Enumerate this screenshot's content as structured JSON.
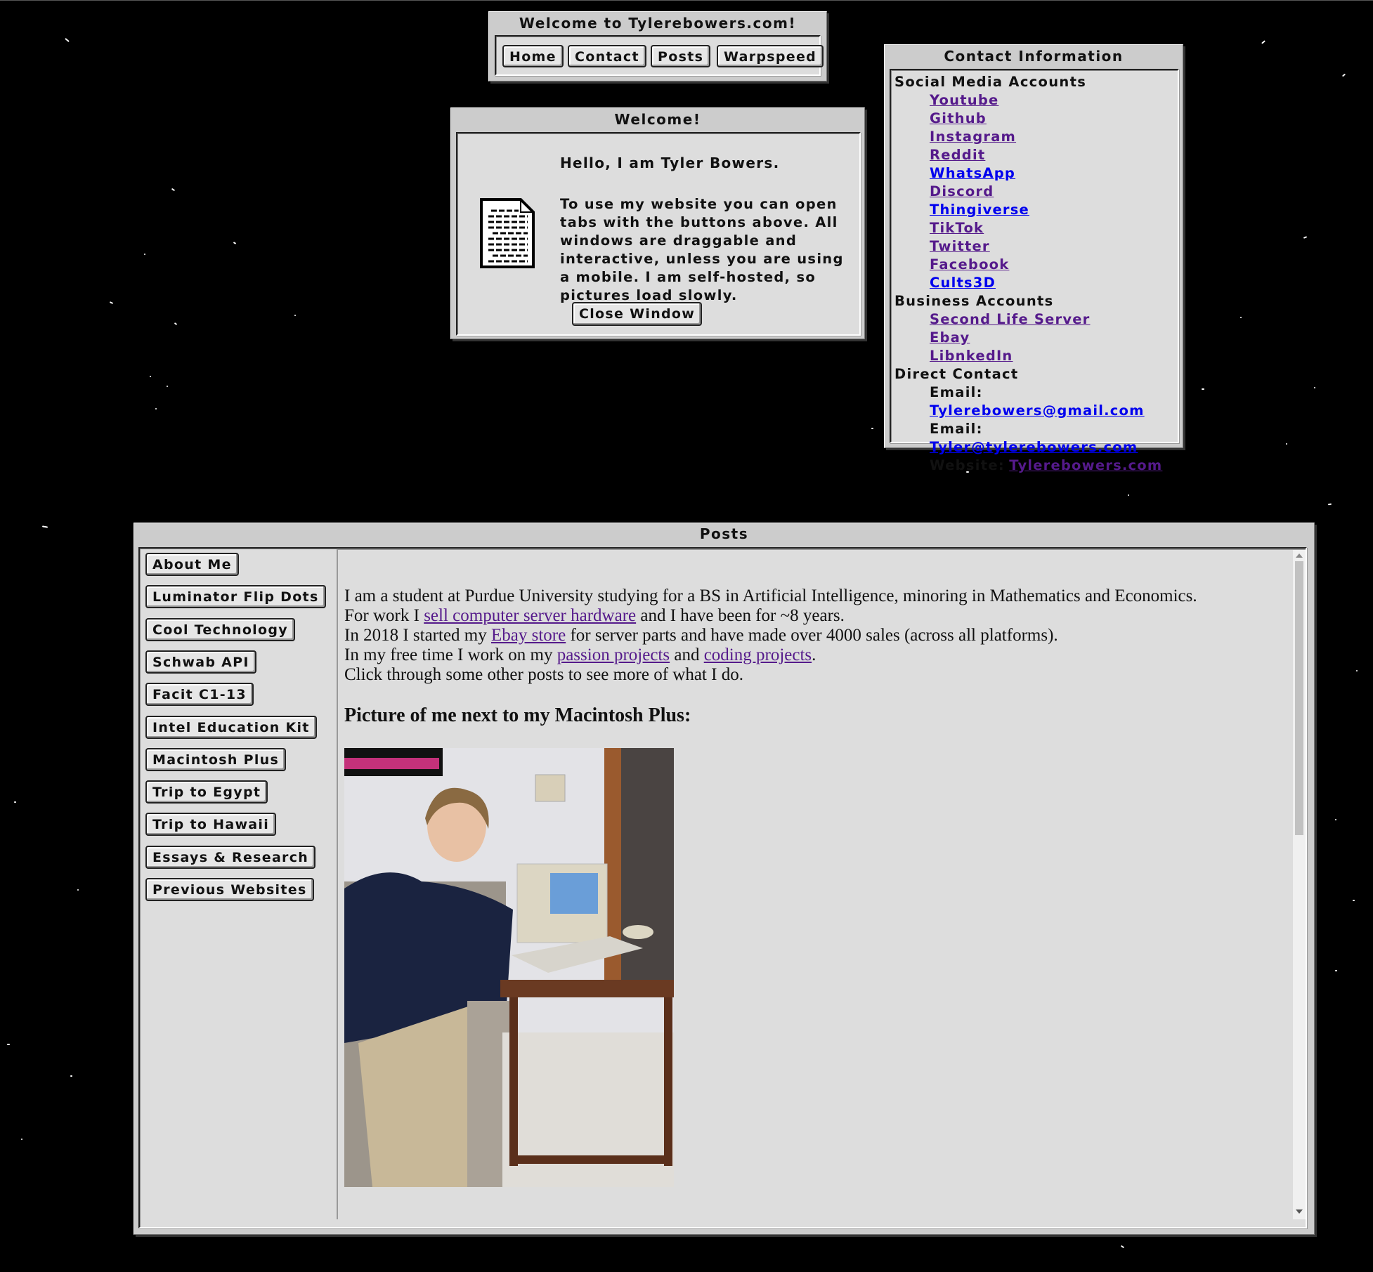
{
  "nav_window": {
    "title": "Welcome to Tylerebowers.com!",
    "buttons": [
      "Home",
      "Contact",
      "Posts",
      "Warpspeed"
    ]
  },
  "welcome_window": {
    "title": "Welcome!",
    "icon": "document-icon",
    "greeting": "Hello, I am Tyler Bowers.",
    "body": "To use my website you can open tabs with the buttons above. All windows are draggable and interactive, unless you are using a mobile. I am self-hosted, so pictures load slowly.",
    "close_label": "Close Window"
  },
  "contact_window": {
    "title": "Contact Information",
    "sections": [
      {
        "heading": "Social Media Accounts",
        "links": [
          {
            "label": "Youtube",
            "visited": true
          },
          {
            "label": "Github",
            "visited": true
          },
          {
            "label": "Instagram",
            "visited": true
          },
          {
            "label": "Reddit",
            "visited": true
          },
          {
            "label": "WhatsApp",
            "visited": false
          },
          {
            "label": "Discord",
            "visited": true
          },
          {
            "label": "Thingiverse",
            "visited": false
          },
          {
            "label": "TikTok",
            "visited": true
          },
          {
            "label": "Twitter",
            "visited": true
          },
          {
            "label": "Facebook",
            "visited": true
          },
          {
            "label": "Cults3D",
            "visited": false
          }
        ]
      },
      {
        "heading": "Business Accounts",
        "links": [
          {
            "label": "Second Life Server",
            "visited": true
          },
          {
            "label": "Ebay",
            "visited": true
          },
          {
            "label": "LibnkedIn",
            "visited": true
          }
        ]
      },
      {
        "heading": "Direct Contact",
        "entries": [
          {
            "prefix": "Email:",
            "label": "Tylerebowers@gmail.com",
            "visited": false
          },
          {
            "prefix": "Email:",
            "label": "Tyler@tylerebowers.com",
            "visited": false
          },
          {
            "prefix": "Website:",
            "label": "Tylerebowers.com",
            "visited": true
          }
        ]
      }
    ]
  },
  "posts_window": {
    "title": "Posts",
    "sidebar": [
      "About Me",
      "Luminator Flip Dots",
      "Cool Technology",
      "Schwab API",
      "Facit C1-13",
      "Intel Education Kit",
      "Macintosh Plus",
      "Trip to Egypt",
      "Trip to Hawaii",
      "Essays & Research",
      "Previous Websites"
    ],
    "content": {
      "line1": "I am a student at Purdue University studying for a BS in Artificial Intelligence, minoring in Mathematics and Economics.",
      "line2_pre": "For work I ",
      "line2_link": "sell computer server hardware",
      "line2_post": " and I have been for ~8 years.",
      "line3_pre": "In 2018 I started my ",
      "line3_link": "Ebay store",
      "line3_post": " for server parts and have made over 4000 sales (across all platforms).",
      "line4_pre": "In my free time I work on my ",
      "line4_link1": "passion projects",
      "line4_mid": " and ",
      "line4_link2": "coding projects",
      "line4_post": ".",
      "line5": "Click through some other posts to see more of what I do.",
      "heading": "Picture of me next to my Macintosh Plus:",
      "photo_alt": "Photo of Tyler sitting on a couch next to a Macintosh Plus on a side table"
    }
  },
  "colors": {
    "background": "#000000",
    "window": "#cccccc",
    "panel": "#dddddd",
    "link_visited": "#551A8B",
    "link_unvisited": "#0000EE"
  }
}
